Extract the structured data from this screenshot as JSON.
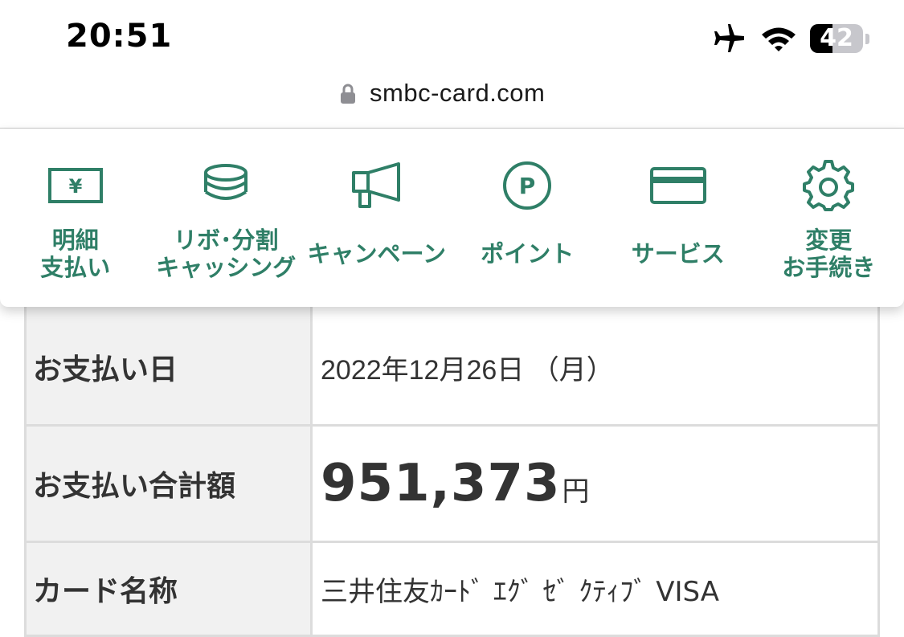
{
  "status_bar": {
    "time": "20:51",
    "battery": "42",
    "battery_level": 0.42,
    "icons": [
      "airplane-icon",
      "wifi-icon",
      "battery-icon"
    ]
  },
  "address_bar": {
    "url": "smbc-card.com",
    "icon": "lock-icon"
  },
  "nav": {
    "accent": "#2f7f67",
    "items": [
      {
        "label": "明細\n支払い",
        "icon": "yen-bill-icon"
      },
      {
        "label": "リボ･分割\nキャッシング",
        "icon": "coins-icon"
      },
      {
        "label": "キャンペーン",
        "icon": "megaphone-icon"
      },
      {
        "label": "ポイント",
        "icon": "point-icon"
      },
      {
        "label": "サービス",
        "icon": "card-icon"
      },
      {
        "label": "変更\nお手続き",
        "icon": "gear-icon"
      }
    ]
  },
  "statement": {
    "rows": [
      {
        "label": "お支払い日",
        "value": "2022年12月26日 （月）"
      },
      {
        "label": "お支払い合計額",
        "amount": "951,373",
        "unit": "円"
      },
      {
        "label": "カード名称",
        "value": "三井住友ｶｰﾄﾞ ｴｸﾞ ｾﾞ ｸﾃｨﾌﾞ VISA"
      }
    ]
  }
}
